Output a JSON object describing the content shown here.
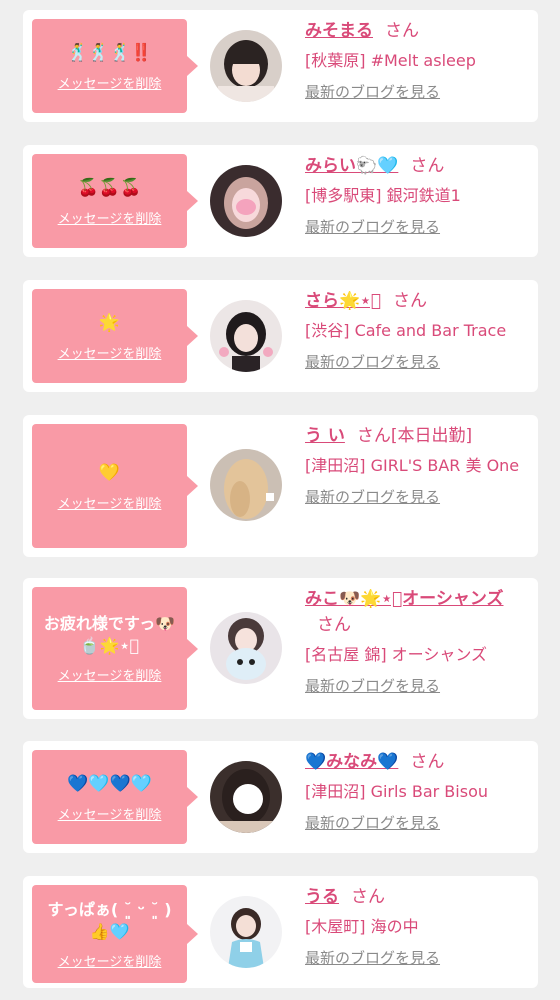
{
  "entries": [
    {
      "message": "🕺🕺🕺‼️",
      "delete_label": "メッセージを削除",
      "name": "みそまる",
      "suffix": "さん",
      "shop": "[秋葉原] #Melt asleep",
      "blog_label": "最新のブログを見る"
    },
    {
      "message": "🍒🍒🍒",
      "delete_label": "メッセージを削除",
      "name": "みらい🐑🩵",
      "suffix": "さん",
      "shop": "[博多駅東] 銀河鉄道1",
      "blog_label": "最新のブログを見る"
    },
    {
      "message": "🌟",
      "delete_label": "メッセージを削除",
      "name": "さら🌟⋆͛",
      "suffix": "さん",
      "shop": "[渋谷] Cafe and Bar Trace",
      "blog_label": "最新のブログを見る"
    },
    {
      "message": "💛",
      "delete_label": "メッセージを削除",
      "name": "う い",
      "suffix": "さん[本日出勤]",
      "shop": "[津田沼] GIRL'S BAR 美 One",
      "blog_label": "最新のブログを見る"
    },
    {
      "message": "お疲れ様ですっ🐶🍵🌟⋆͛",
      "delete_label": "メッセージを削除",
      "name": "みこ🐶🌟⋆͛オーシャンズ",
      "suffix": "さん",
      "shop": "[名古屋 錦] オーシャンズ",
      "blog_label": "最新のブログを見る"
    },
    {
      "message": "💙🩵💙🩵",
      "delete_label": "メッセージを削除",
      "name": "💙みなみ💙",
      "suffix": "さん",
      "shop": "[津田沼] Girls Bar Bisou",
      "blog_label": "最新のブログを見る"
    },
    {
      "message": "すっぱぁ( ˘͈ ᵕ ˘͈ )👍🩵",
      "delete_label": "メッセージを削除",
      "name": "うる",
      "suffix": "さん",
      "shop": "[木屋町] 海の中",
      "blog_label": "最新のブログを見る"
    }
  ],
  "colors": {
    "accent_pink": "#d94a79",
    "bubble_pink": "#f99aa6",
    "background": "#efefef",
    "card": "#ffffff",
    "link_gray": "#8a8a8a"
  }
}
